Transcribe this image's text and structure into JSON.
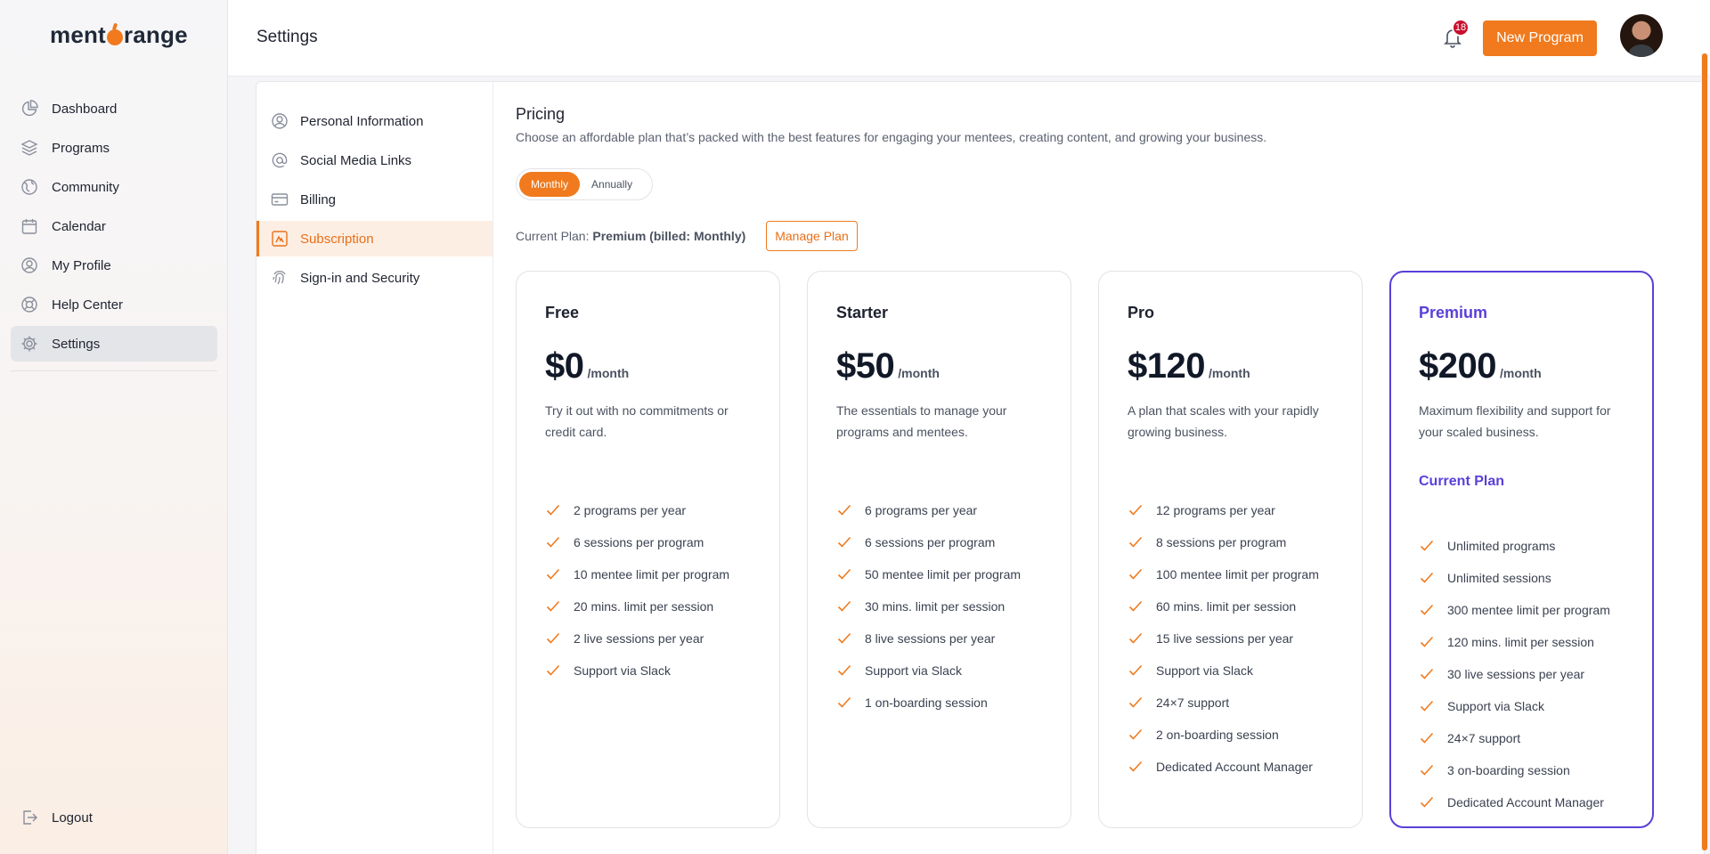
{
  "brand": {
    "logo_left": "ment",
    "logo_right": "range"
  },
  "sidebar": {
    "items": [
      {
        "label": "Dashboard",
        "icon": "pie-chart-icon"
      },
      {
        "label": "Programs",
        "icon": "layers-icon"
      },
      {
        "label": "Community",
        "icon": "globe-icon"
      },
      {
        "label": "Calendar",
        "icon": "calendar-icon"
      },
      {
        "label": "My Profile",
        "icon": "user-circle-icon"
      },
      {
        "label": "Help Center",
        "icon": "lifebuoy-icon"
      },
      {
        "label": "Settings",
        "icon": "gear-icon",
        "active": true
      }
    ],
    "logout": "Logout"
  },
  "header": {
    "title": "Settings",
    "notification_count": "18",
    "new_program": "New Program"
  },
  "settings_nav": {
    "items": [
      {
        "label": "Personal Information",
        "icon": "user-circle-icon"
      },
      {
        "label": "Social Media Links",
        "icon": "at-sign-icon"
      },
      {
        "label": "Billing",
        "icon": "credit-card-icon"
      },
      {
        "label": "Subscription",
        "icon": "subscription-icon",
        "active": true
      },
      {
        "label": "Sign-in and Security",
        "icon": "fingerprint-icon"
      }
    ]
  },
  "pricing": {
    "title": "Pricing",
    "subtitle": "Choose an affordable plan that’s packed with the best features for engaging your mentees, creating content, and growing your business.",
    "billing_toggle": {
      "monthly": "Monthly",
      "annually": "Annually",
      "selected": "Monthly"
    },
    "current_plan_label": "Current Plan:",
    "current_plan_value": "Premium (billed: Monthly)",
    "manage_plan": "Manage Plan",
    "plans": [
      {
        "name": "Free",
        "price": "$0",
        "period": "/month",
        "description": "Try it out with no commitments or credit card.",
        "features": [
          "2 programs per year",
          "6 sessions per program",
          "10 mentee limit per program",
          "20 mins. limit per session",
          "2 live sessions per year",
          "Support via Slack"
        ]
      },
      {
        "name": "Starter",
        "price": "$50",
        "period": "/month",
        "description": "The essentials to manage your programs and mentees.",
        "features": [
          "6 programs per year",
          "6 sessions per program",
          "50 mentee limit per program",
          "30 mins. limit per session",
          "8 live sessions per year",
          "Support via Slack",
          "1 on-boarding session"
        ]
      },
      {
        "name": "Pro",
        "price": "$120",
        "period": "/month",
        "description": "A plan that scales with your rapidly growing business.",
        "features": [
          "12 programs per year",
          "8 sessions per program",
          "100 mentee limit per program",
          "60 mins. limit per session",
          "15 live sessions per year",
          "Support via Slack",
          "24×7 support",
          "2 on-boarding session",
          "Dedicated Account Manager"
        ]
      },
      {
        "name": "Premium",
        "price": "$200",
        "period": "/month",
        "description": "Maximum flexibility and support for your scaled business.",
        "current_tag": "Current Plan",
        "features": [
          "Unlimited programs",
          "Unlimited sessions",
          "300 mentee limit per program",
          "120 mins. limit per session",
          "30 live sessions per year",
          "Support via Slack",
          "24×7 support",
          "3 on-boarding session",
          "Dedicated Account Manager"
        ]
      }
    ]
  },
  "colors": {
    "accent": "#f07a1d",
    "premium": "#5b3fd9",
    "badge": "#c8102e"
  }
}
